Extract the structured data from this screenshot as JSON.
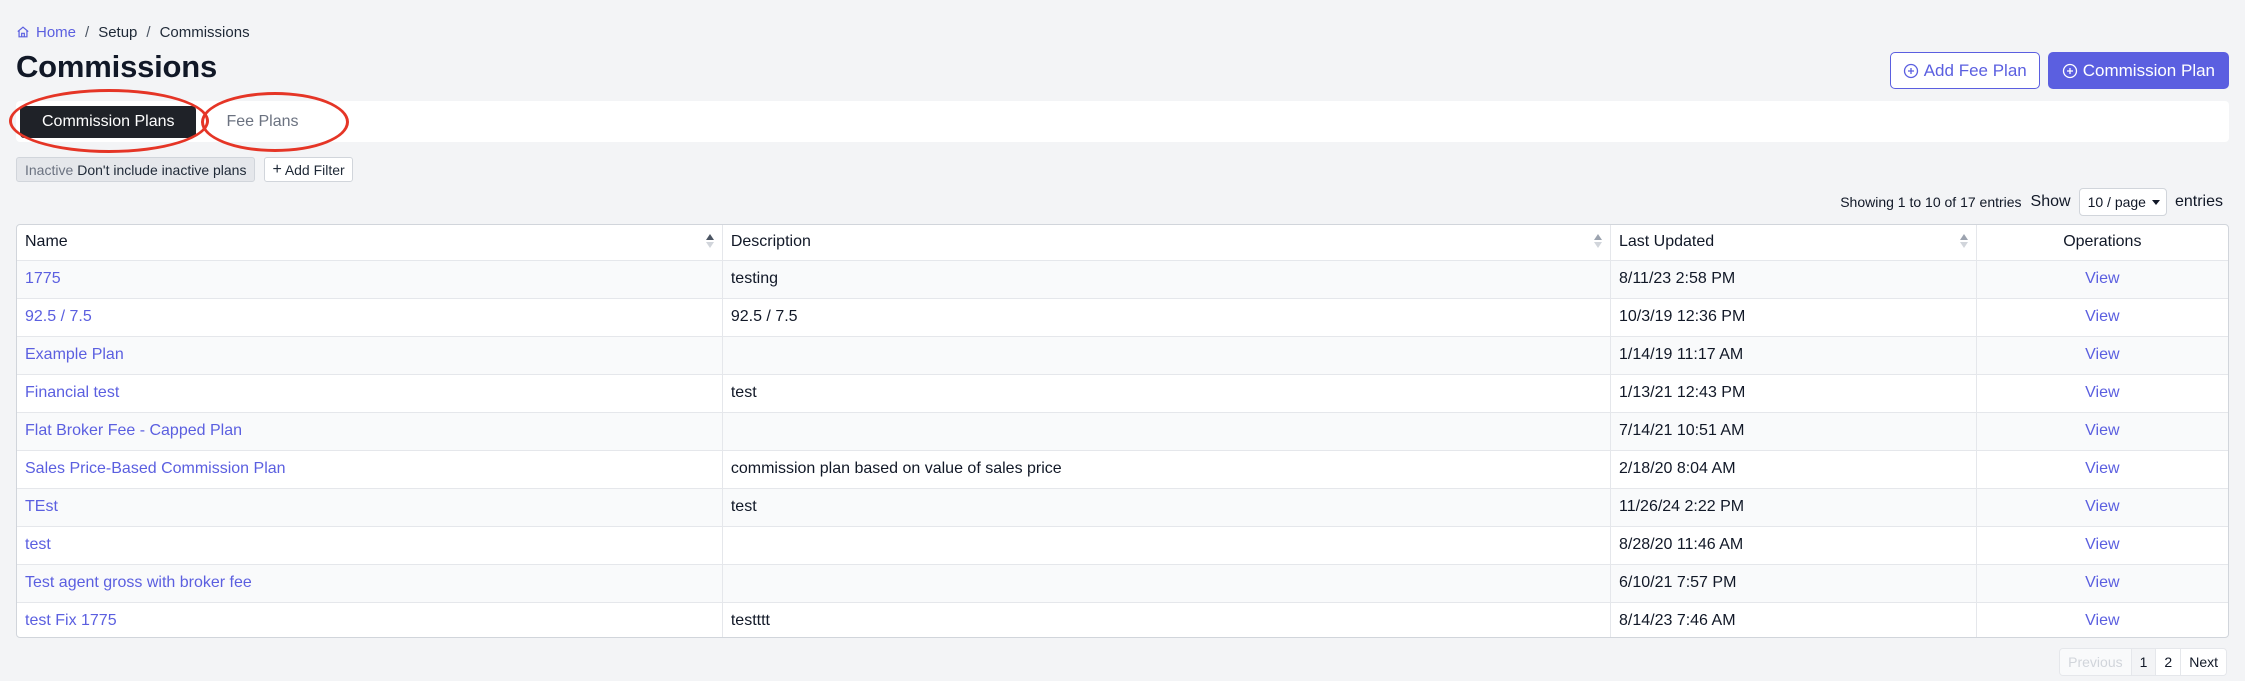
{
  "breadcrumb": {
    "home": "Home",
    "setup": "Setup",
    "current": "Commissions",
    "separator": "/"
  },
  "page_title": "Commissions",
  "actions": {
    "add_fee_plan": "Add Fee Plan",
    "commission_plan": "Commission Plan"
  },
  "tabs": {
    "commission_plans": "Commission Plans",
    "fee_plans": "Fee Plans"
  },
  "filters": {
    "chip_key": "Inactive",
    "chip_value": "Don't include inactive plans",
    "add_filter": "Add Filter"
  },
  "entries": {
    "showing": "Showing 1 to 10 of 17 entries",
    "show": "Show",
    "page_size": "10 / page",
    "entries_label": "entries"
  },
  "table": {
    "headers": {
      "name": "Name",
      "description": "Description",
      "last_updated": "Last Updated",
      "operations": "Operations"
    },
    "rows": [
      {
        "name": "1775",
        "description": "testing",
        "updated": "8/11/23 2:58 PM",
        "op": "View"
      },
      {
        "name": "92.5 / 7.5",
        "description": "92.5 / 7.5",
        "updated": "10/3/19 12:36 PM",
        "op": "View"
      },
      {
        "name": "Example Plan",
        "description": "",
        "updated": "1/14/19 11:17 AM",
        "op": "View"
      },
      {
        "name": "Financial test",
        "description": "test",
        "updated": "1/13/21 12:43 PM",
        "op": "View"
      },
      {
        "name": "Flat Broker Fee - Capped Plan",
        "description": "",
        "updated": "7/14/21 10:51 AM",
        "op": "View"
      },
      {
        "name": "Sales Price-Based Commission Plan",
        "description": "commission plan based on value of sales price",
        "updated": "2/18/20 8:04 AM",
        "op": "View"
      },
      {
        "name": "TEst",
        "description": "test",
        "updated": "11/26/24 2:22 PM",
        "op": "View"
      },
      {
        "name": "test",
        "description": "",
        "updated": "8/28/20 11:46 AM",
        "op": "View"
      },
      {
        "name": "Test agent gross with broker fee",
        "description": "",
        "updated": "6/10/21 7:57 PM",
        "op": "View"
      },
      {
        "name": "test Fix 1775",
        "description": "testttt",
        "updated": "8/14/23 7:46 AM",
        "op": "View"
      }
    ]
  },
  "pagination": {
    "previous": "Previous",
    "page1": "1",
    "page2": "2",
    "next": "Next"
  },
  "colors": {
    "accent": "#5b5fe0",
    "tab_active_bg": "#1f2228",
    "annotation": "#e53526"
  }
}
